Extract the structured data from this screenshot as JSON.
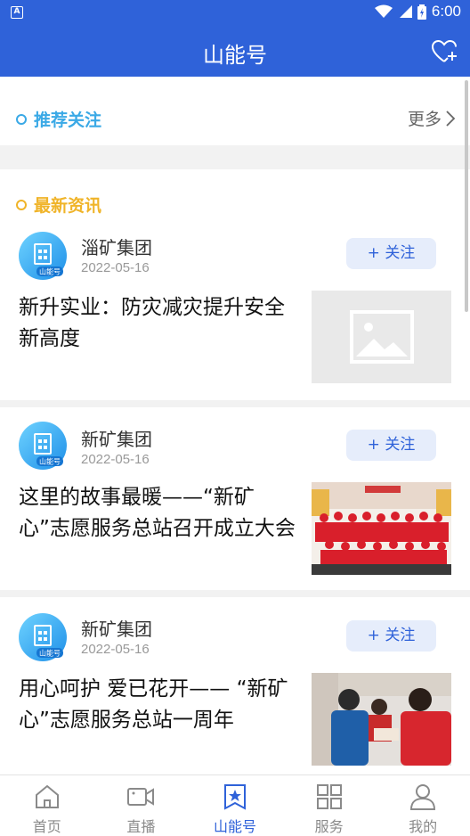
{
  "status_bar": {
    "time": "6:00",
    "left_badge": "A"
  },
  "header": {
    "title": "山能号"
  },
  "recommend": {
    "title": "推荐关注",
    "more_label": "更多",
    "accent": "#3aa9e6"
  },
  "latest": {
    "title": "最新资讯",
    "accent": "#f0b429"
  },
  "feed": [
    {
      "source": "淄矿集团",
      "date": "2022-05-16",
      "follow_label": "+ 关注",
      "headline": "新升实业：防灾减灾提升安全新高度",
      "avatar_label": "山能号",
      "thumb": "placeholder"
    },
    {
      "source": "新矿集团",
      "date": "2022-05-16",
      "follow_label": "+ 关注",
      "headline": "这里的故事最暖——“新矿心”志愿服务总站召开成立大会",
      "avatar_label": "山能号",
      "thumb": "group-photo"
    },
    {
      "source": "新矿集团",
      "date": "2022-05-16",
      "follow_label": "+ 关注",
      "headline": "用心呵护 爱已花开—— “新矿心”志愿服务总站一周年",
      "avatar_label": "山能号",
      "thumb": "volunteer-photo"
    }
  ],
  "tabs": [
    {
      "label": "首页",
      "icon": "home-icon",
      "active": false
    },
    {
      "label": "直播",
      "icon": "video-camera-icon",
      "active": false
    },
    {
      "label": "山能号",
      "icon": "star-badge-icon",
      "active": true
    },
    {
      "label": "服务",
      "icon": "grid-icon",
      "active": false
    },
    {
      "label": "我的",
      "icon": "user-icon",
      "active": false
    }
  ],
  "colors": {
    "primary": "#2f62d9",
    "follow_bg": "#e6edfb"
  }
}
